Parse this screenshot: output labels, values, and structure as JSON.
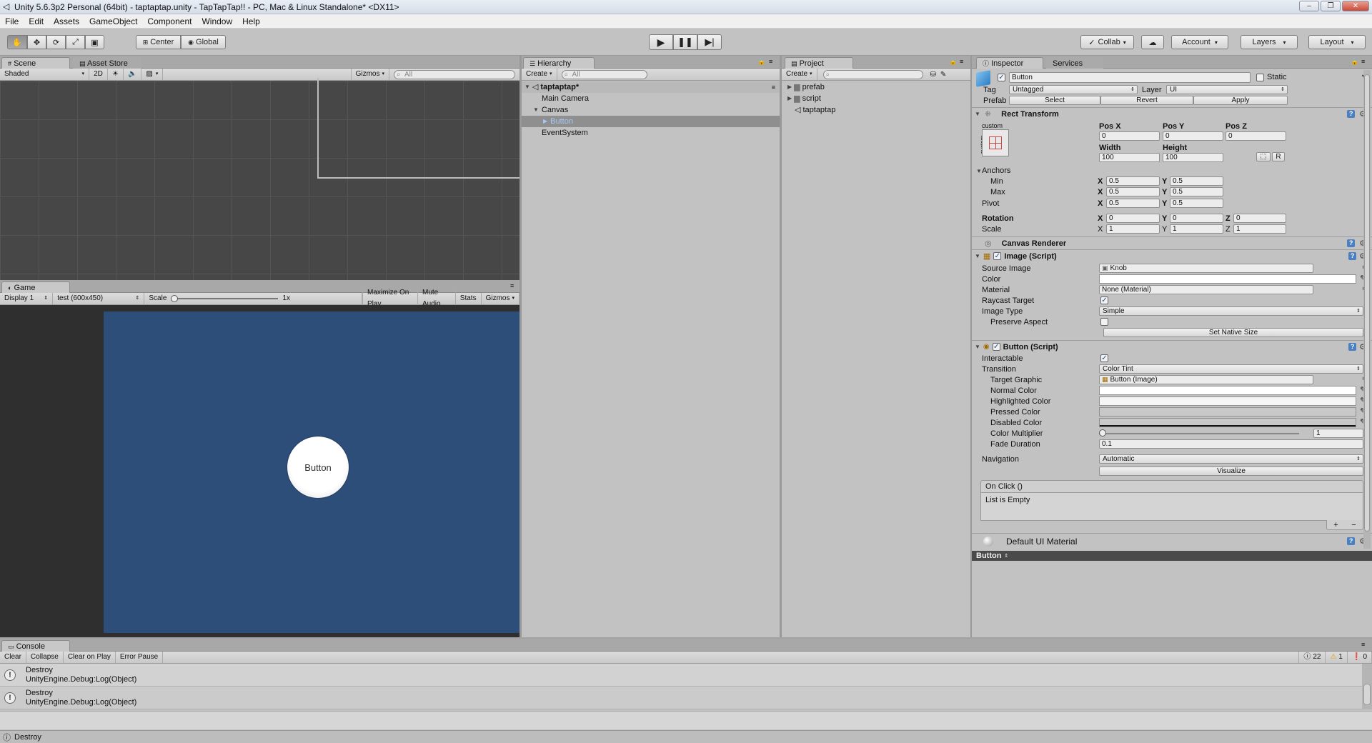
{
  "window": {
    "title": "Unity 5.6.3p2 Personal (64bit) - taptaptap.unity - TapTapTap!! - PC, Mac & Linux Standalone* <DX11>"
  },
  "menu": [
    "File",
    "Edit",
    "Assets",
    "GameObject",
    "Component",
    "Window",
    "Help"
  ],
  "toolbar": {
    "center_label": "Center",
    "global_label": "Global",
    "collab_label": "Collab",
    "account_label": "Account",
    "layers_label": "Layers",
    "layout_label": "Layout"
  },
  "scene": {
    "tab": "Scene",
    "tab2": "Asset Store",
    "shading": "Shaded",
    "mode2d": "2D",
    "gizmos": "Gizmos",
    "search_placeholder": "All"
  },
  "game": {
    "tab": "Game",
    "display": "Display 1",
    "resolution": "test (600x450)",
    "scale_label": "Scale",
    "scale_value": "1x",
    "maximize": "Maximize On Play",
    "mute": "Mute Audio",
    "stats": "Stats",
    "gizmos": "Gizmos",
    "button_text": "Button",
    "background_color": "#2e4e7a"
  },
  "hierarchy": {
    "tab": "Hierarchy",
    "create": "Create",
    "search_placeholder": "All",
    "scene_name": "taptaptap*",
    "items": [
      "Main Camera",
      "Canvas",
      "Button",
      "EventSystem"
    ]
  },
  "project": {
    "tab": "Project",
    "create": "Create",
    "items": [
      "prefab",
      "script",
      "taptaptap"
    ]
  },
  "inspector": {
    "tab": "Inspector",
    "tab2": "Services",
    "object_name": "Button",
    "static_label": "Static",
    "tag_label": "Tag",
    "tag_value": "Untagged",
    "layer_label": "Layer",
    "layer_value": "UI",
    "prefab_label": "Prefab",
    "prefab_select": "Select",
    "prefab_revert": "Revert",
    "prefab_apply": "Apply",
    "rect": {
      "title": "Rect Transform",
      "custom": "custom",
      "posx_label": "Pos X",
      "posy_label": "Pos Y",
      "posz_label": "Pos Z",
      "posx": "0",
      "posy": "0",
      "posz": "0",
      "width_label": "Width",
      "height_label": "Height",
      "width": "100",
      "height": "100",
      "anchors": "Anchors",
      "min": "Min",
      "max": "Max",
      "min_x": "0.5",
      "min_y": "0.5",
      "max_x": "0.5",
      "max_y": "0.5",
      "pivot": "Pivot",
      "pivot_x": "0.5",
      "pivot_y": "0.5",
      "rotation": "Rotation",
      "rot_x": "0",
      "rot_y": "0",
      "rot_z": "0",
      "scale": "Scale",
      "scale_x": "1",
      "scale_y": "1",
      "scale_z": "1",
      "x": "X",
      "y": "Y",
      "z": "Z",
      "r": "R"
    },
    "canvas_renderer": "Canvas Renderer",
    "image": {
      "title": "Image (Script)",
      "source_image_label": "Source Image",
      "source_image": "Knob",
      "color_label": "Color",
      "material_label": "Material",
      "material": "None (Material)",
      "raycast_label": "Raycast Target",
      "image_type_label": "Image Type",
      "image_type": "Simple",
      "preserve_label": "Preserve Aspect",
      "native_size": "Set Native Size"
    },
    "button": {
      "title": "Button (Script)",
      "interactable_label": "Interactable",
      "transition_label": "Transition",
      "transition": "Color Tint",
      "target_graphic_label": "Target Graphic",
      "target_graphic": "Button (Image)",
      "normal_label": "Normal Color",
      "highlighted_label": "Highlighted Color",
      "pressed_label": "Pressed Color",
      "disabled_label": "Disabled Color",
      "multiplier_label": "Color Multiplier",
      "multiplier": "1",
      "fade_label": "Fade Duration",
      "fade": "0.1",
      "navigation_label": "Navigation",
      "navigation": "Automatic",
      "visualize": "Visualize",
      "onclick": "On Click ()",
      "list_empty": "List is Empty",
      "plus": "+",
      "minus": "−"
    },
    "material_footer": "Default UI Material",
    "preview_label": "Button"
  },
  "console": {
    "tab": "Console",
    "clear": "Clear",
    "collapse": "Collapse",
    "clear_on_play": "Clear on Play",
    "error_pause": "Error Pause",
    "count_log": "22",
    "count_warn": "1",
    "count_err": "0",
    "entries": [
      {
        "line1": "Destroy",
        "line2": "UnityEngine.Debug:Log(Object)"
      },
      {
        "line1": "Destroy",
        "line2": "UnityEngine.Debug:Log(Object)"
      }
    ],
    "status": "Destroy"
  }
}
